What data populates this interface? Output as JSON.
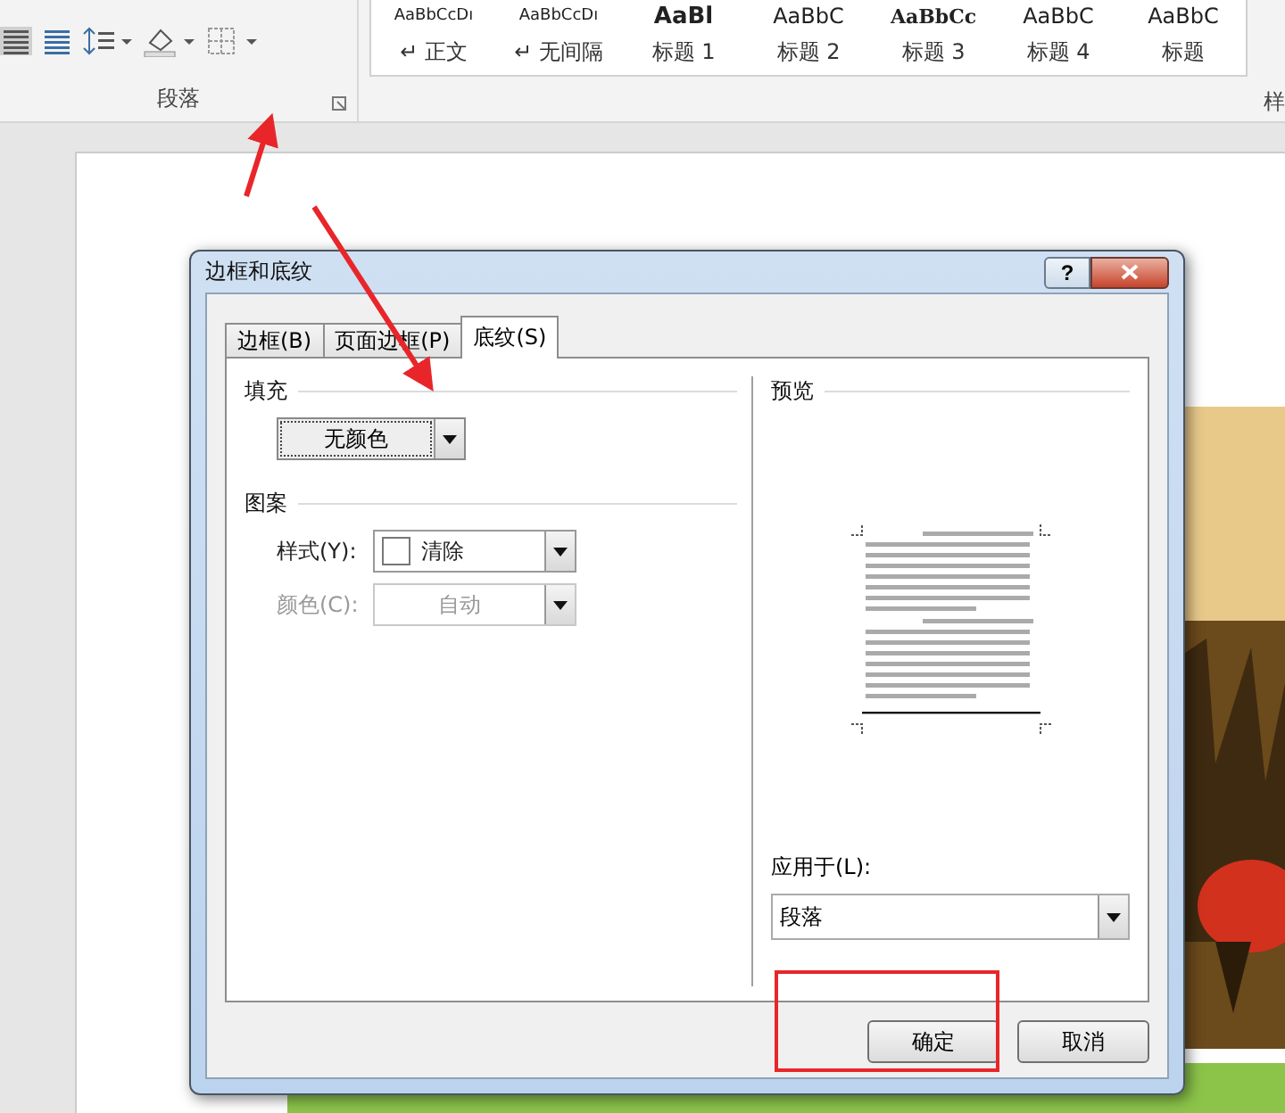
{
  "ribbon": {
    "paragraph_label": "段落",
    "styles_label": "样",
    "styles": [
      {
        "sample": "AaBbCcDı",
        "name": "↵ 正文",
        "kind": "small"
      },
      {
        "sample": "AaBbCcDı",
        "name": "↵ 无间隔",
        "kind": "small"
      },
      {
        "sample": "AaBl",
        "name": "标题 1",
        "kind": "heavy"
      },
      {
        "sample": "AaBbC",
        "name": "标题 2",
        "kind": "large"
      },
      {
        "sample": "AaBbCc",
        "name": "标题 3",
        "kind": "bold"
      },
      {
        "sample": "AaBbC",
        "name": "标题 4",
        "kind": "large"
      },
      {
        "sample": "AaBbC",
        "name": "标题",
        "kind": "large"
      }
    ]
  },
  "dialog": {
    "title": "边框和底纹",
    "help": "?",
    "tabs": [
      {
        "label": "边框(B)",
        "selected": false
      },
      {
        "label": "页面边框(P)",
        "selected": false
      },
      {
        "label": "底纹(S)",
        "selected": true
      }
    ],
    "fill": {
      "label": "填充",
      "value": "无颜色"
    },
    "pattern": {
      "label": "图案",
      "fields": [
        {
          "label": "样式(Y):",
          "value": "清除",
          "disabled": false,
          "swatch": true
        },
        {
          "label": "颜色(C):",
          "value": "自动",
          "disabled": true,
          "swatch": false
        }
      ]
    },
    "preview": {
      "label": "预览"
    },
    "apply_to": {
      "label": "应用于(L):",
      "value": "段落"
    },
    "buttons": [
      {
        "label": "确定",
        "highlighted": true
      },
      {
        "label": "取消",
        "highlighted": false
      }
    ]
  }
}
